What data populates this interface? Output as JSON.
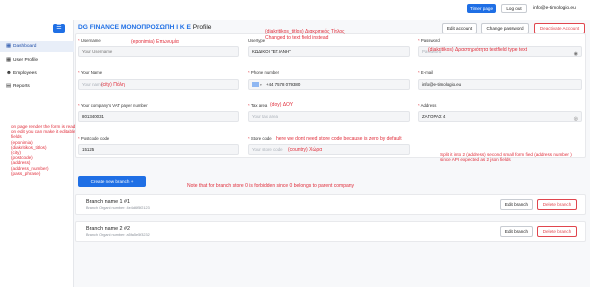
{
  "topbar": {
    "timer_label": "Timer page",
    "logout_label": "Log out",
    "email": "info@e-timologio.eu"
  },
  "sidebar": {
    "items": [
      {
        "label": "Dashboard",
        "icon": "dashboard-icon"
      },
      {
        "label": "User Profile",
        "icon": "grid-icon"
      },
      {
        "label": "Employees",
        "icon": "user-icon"
      },
      {
        "label": "Reports",
        "icon": "reports-icon"
      }
    ]
  },
  "header": {
    "company": "DG FINANCE ΜΟΝΟΠΡΟΣΩΠΗ Ι Κ Ε",
    "page": "Profile",
    "edit_account": "Edit account",
    "change_password": "Change password",
    "deactivate_account": "Deactivate Account"
  },
  "form": {
    "username": {
      "label": "Username",
      "placeholder": "Your Username"
    },
    "usertype": {
      "label": "Usertype",
      "value": "ΚΩΔΙΚΟΙ \"ΕΓ.ΙΑΝΗ\""
    },
    "password": {
      "label": "Password",
      "placeholder": "Password"
    },
    "name": {
      "label": "Your Name",
      "placeholder": "Your name"
    },
    "phone": {
      "label": "Phone number",
      "value": "+44 7578 079380"
    },
    "email": {
      "label": "E-mail",
      "value": "info@e-timologio.eu"
    },
    "vat": {
      "label": "Your company's VAT payer number",
      "value": "801340031"
    },
    "tax_area": {
      "label": "Tax area",
      "placeholder": "Your tax area"
    },
    "address": {
      "label": "Address",
      "value": "ΖΑΓΟΡΑΣ 4"
    },
    "postcode": {
      "label": "Postcode code",
      "value": "15125"
    },
    "store_code": {
      "label": "Store code",
      "placeholder": "Your store code"
    }
  },
  "annotations": {
    "username": "(eponimia) Επωνυμία",
    "usertype": "(diakritikos_titlos) Διακριτικός Τίτλος\nChanged to text field instead",
    "password": "(diakritikos) Δραστηριότητα textfield type text",
    "name": "(city) Πόλη",
    "tax_area": "(doy) ΔΟΥ",
    "store_code": "here we dont need store code because is zero by default",
    "country": "(country) Χώρα",
    "left_block": "on page render the form is readonly every field\non edit you can make it editable the folowing\nfields\n(eponimia)\n(diakritikos_titlos)\n(city)\n(postcode)\n(address)\n(address_number)\n(pass_phrase)",
    "address": "Split it into 2 (address) second small form fied (address number )\nsince API expected as 2 json fields",
    "branch_note": "Note that for branch store 0 is forbidden since 0 belongs to parent company"
  },
  "branches": {
    "create_label": "Create new branch +",
    "items": [
      {
        "title": "Branch name 1 #1",
        "subtitle": "Branch Organi number: 4e4d6f5f2123",
        "edit": "Edit branch",
        "delete": "Delete branch"
      },
      {
        "title": "Branch name 2 #2",
        "subtitle": "Branch Organi number: a5fa5e5f3232",
        "edit": "Edit branch",
        "delete": "Delete branch"
      }
    ]
  },
  "colors": {
    "accent": "#1f6fe5",
    "danger": "#e0464e",
    "note": "#e02d3a"
  }
}
